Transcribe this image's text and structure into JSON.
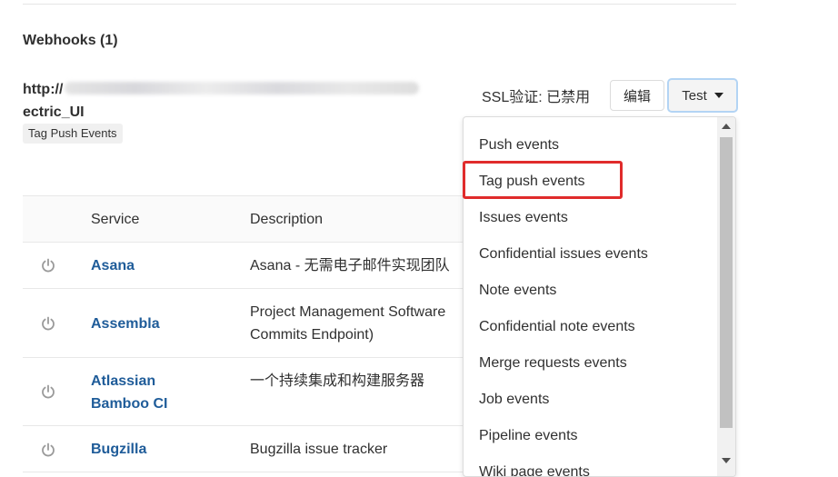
{
  "webhooks": {
    "heading": "Webhooks (1)",
    "url_start": "http://",
    "url_end": "ectric_UI",
    "tag": "Tag Push Events",
    "ssl_status": "SSL验证: 已禁用",
    "edit_label": "编辑",
    "test_label": "Test"
  },
  "table": {
    "headers": [
      "Service",
      "Description"
    ],
    "rows": [
      {
        "service": "Asana",
        "description": "Asana - 无需电子邮件实现团队"
      },
      {
        "service": "Assembla",
        "description_line1": "Project Management Software",
        "description_line2": "Commits Endpoint)"
      },
      {
        "service_line1": "Atlassian",
        "service_line2": "Bamboo CI",
        "description": "一个持续集成和构建服务器"
      },
      {
        "service": "Bugzilla",
        "description": "Bugzilla issue tracker"
      }
    ]
  },
  "test_menu": {
    "items": [
      "Push events",
      "Tag push events",
      "Issues events",
      "Confidential issues events",
      "Note events",
      "Confidential note events",
      "Merge requests events",
      "Job events",
      "Pipeline events",
      "Wiki page events"
    ],
    "highlighted": "Tag push events"
  },
  "colors": {
    "link": "#1f5c99",
    "highlight": "#e02b2b",
    "focus_ring": "#b3d4f4"
  }
}
